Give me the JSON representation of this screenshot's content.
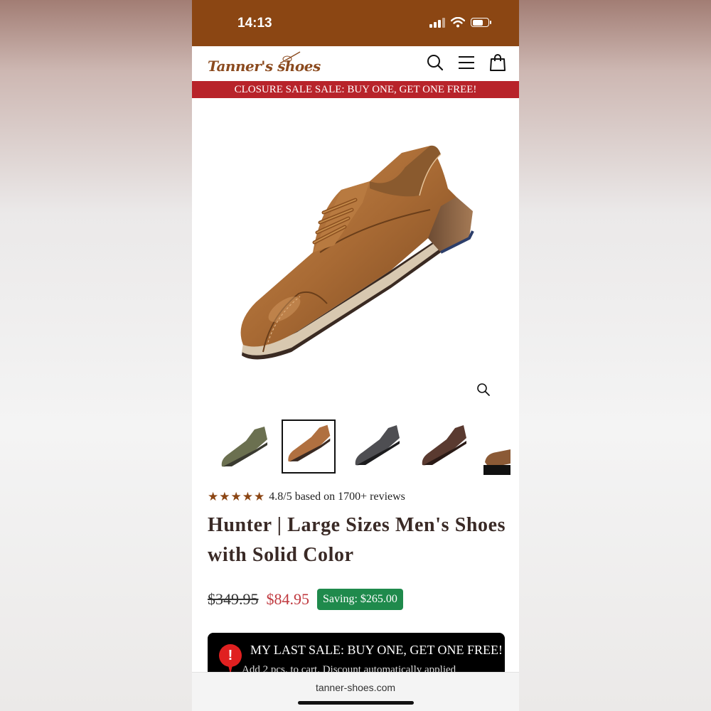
{
  "status_bar": {
    "time": "14:13"
  },
  "header": {
    "logo_text": "Tanner's shoes"
  },
  "promo_bar": {
    "text": "CLOSURE SALE SALE: BUY ONE, GET ONE FREE!"
  },
  "gallery": {
    "thumbnails": [
      "olive",
      "tan",
      "grey",
      "dark-brown",
      "brown"
    ],
    "selected_index": 1
  },
  "rating": {
    "stars": 5,
    "text": "4.8/5 based on 1700+ reviews"
  },
  "product": {
    "title": "Hunter | Large Sizes Men's Shoes with Solid Color",
    "old_price": "$349.95",
    "new_price": "$84.95",
    "saving": "Saving: $265.00"
  },
  "sale_box": {
    "icon": "!",
    "title": "MY LAST SALE: BUY ONE, GET ONE FREE!",
    "subtitle": "Add 2 pcs. to cart. Discount automatically applied"
  },
  "browser": {
    "url": "tanner-shoes.com"
  },
  "colors": {
    "status_bar": "#8b4613",
    "promo": "#b8232a",
    "price_new": "#c0393f",
    "saving_badge": "#1f8a4c",
    "stars": "#8b4513"
  }
}
